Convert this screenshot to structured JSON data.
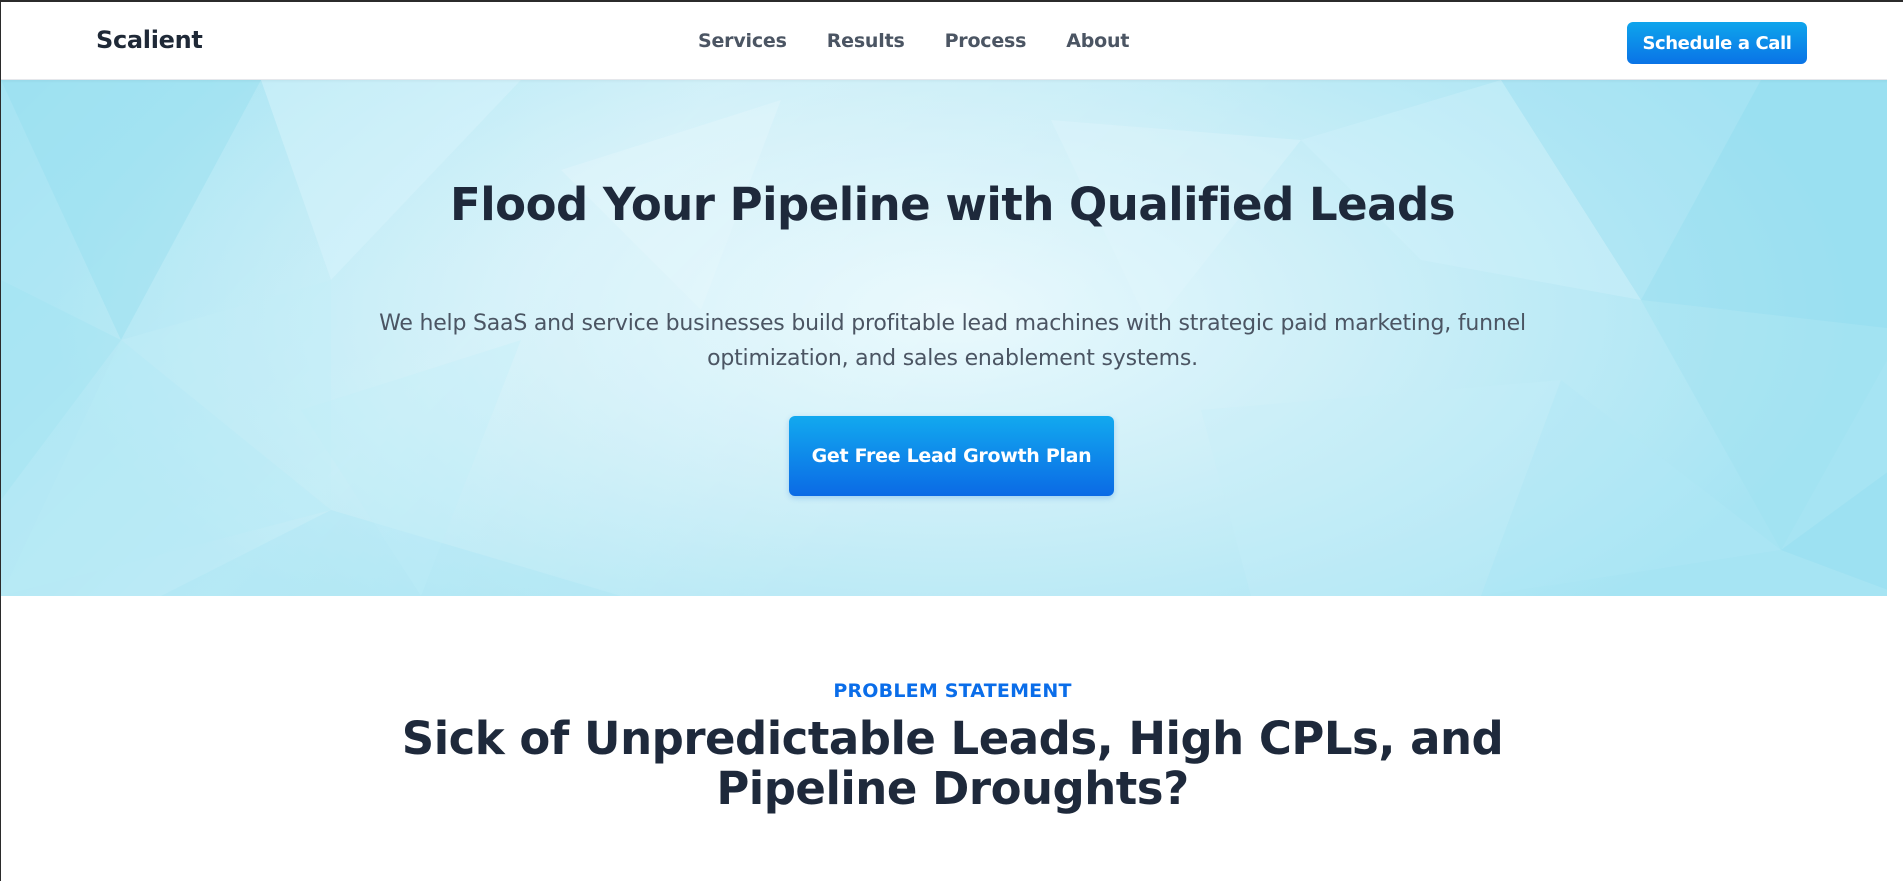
{
  "header": {
    "logo": "Scalient",
    "nav": [
      "Services",
      "Results",
      "Process",
      "About"
    ],
    "cta": "Schedule a Call"
  },
  "hero": {
    "title": "Flood Your Pipeline with Qualified Leads",
    "subtitle": "We help SaaS and service businesses build profitable lead machines with strategic paid marketing, funnel optimization, and sales enablement systems.",
    "cta": "Get Free Lead Growth Plan"
  },
  "problem": {
    "eyebrow": "PROBLEM STATEMENT",
    "title": "Sick of Unpredictable Leads, High CPLs, and Pipeline Droughts?"
  },
  "colors": {
    "accent": "#0a6de9",
    "heading": "#1e293b",
    "hero_bg": "#cdeff8"
  }
}
